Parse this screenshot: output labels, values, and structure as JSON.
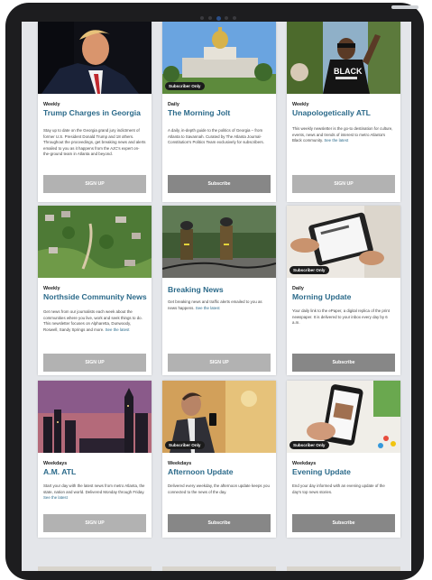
{
  "newsletters": [
    {
      "frequency": "Weekly",
      "title": "Trump Charges in Georgia",
      "badge": "",
      "description": "Stay up to date on the Georgia grand jury indictment of former U.S. President Donald Trump and 18 others. Throughout the proceedings, get breaking news and alerts emailed to you as it happens from the AJC's expert on-the-ground team in Atlanta and beyond.",
      "see_latest": "",
      "button_label": "SIGN UP",
      "button_style": "light"
    },
    {
      "frequency": "Daily",
      "title": "The Morning Jolt",
      "badge": "Subscriber Only",
      "description": "A daily, in-depth guide to the politics of Georgia – from Atlanta to Savannah. Curated by The Atlanta Journal-Constitution's Politics Team exclusively for subscribers.",
      "see_latest": "",
      "button_label": "Subscribe",
      "button_style": "dark"
    },
    {
      "frequency": "Weekly",
      "title": "Unapologetically ATL",
      "badge": "",
      "description": "This weekly newsletter is the go-to destination for culture, events, news and trends of interest to metro Atlanta's Black community.",
      "see_latest": "See the latest",
      "button_label": "SIGN UP",
      "button_style": "light"
    },
    {
      "frequency": "Weekly",
      "title": "Northside Community News",
      "badge": "",
      "description": "Get news from our journalists each week about the communities where you live, work and seek things to do. This newsletter focuses on Alpharetta, Dunwoody, Roswell, Sandy Springs and more.",
      "see_latest": "See the latest",
      "button_label": "SIGN UP",
      "button_style": "light"
    },
    {
      "frequency": "",
      "title": "Breaking News",
      "badge": "",
      "description": "Get breaking news and traffic alerts emailed to you as news happens.",
      "see_latest": "See the latest",
      "button_label": "SIGN UP",
      "button_style": "light"
    },
    {
      "frequency": "Daily",
      "title": "Morning Update",
      "badge": "Subscriber Only",
      "description": "Your daily link to the ePaper, a digital replica of the print newspaper. It is delivered to your inbox every day by 6 a.m.",
      "see_latest": "",
      "button_label": "Subscribe",
      "button_style": "dark"
    },
    {
      "frequency": "Weekdays",
      "title": "A.M. ATL",
      "badge": "",
      "description": "Start your day with the latest news from metro Atlanta, the state, nation and world. Delivered Monday through Friday.",
      "see_latest": "See the latest",
      "button_label": "SIGN UP",
      "button_style": "light"
    },
    {
      "frequency": "Weekdays",
      "title": "Afternoon Update",
      "badge": "Subscriber Only",
      "description": "Delivered every weekday, the afternoon update keeps you connected to the news of the day.",
      "see_latest": "",
      "button_label": "Subscribe",
      "button_style": "dark"
    },
    {
      "frequency": "Weekdays",
      "title": "Evening Update",
      "badge": "Subscriber Only",
      "description": "End your day informed with an evening update of the day's top news stories.",
      "see_latest": "",
      "button_label": "Subscribe",
      "button_style": "dark"
    }
  ],
  "colors": {
    "title": "#2b6a8a",
    "button_light": "#b2b2b2",
    "button_dark": "#878787",
    "bezel": "#1d1d1f"
  }
}
